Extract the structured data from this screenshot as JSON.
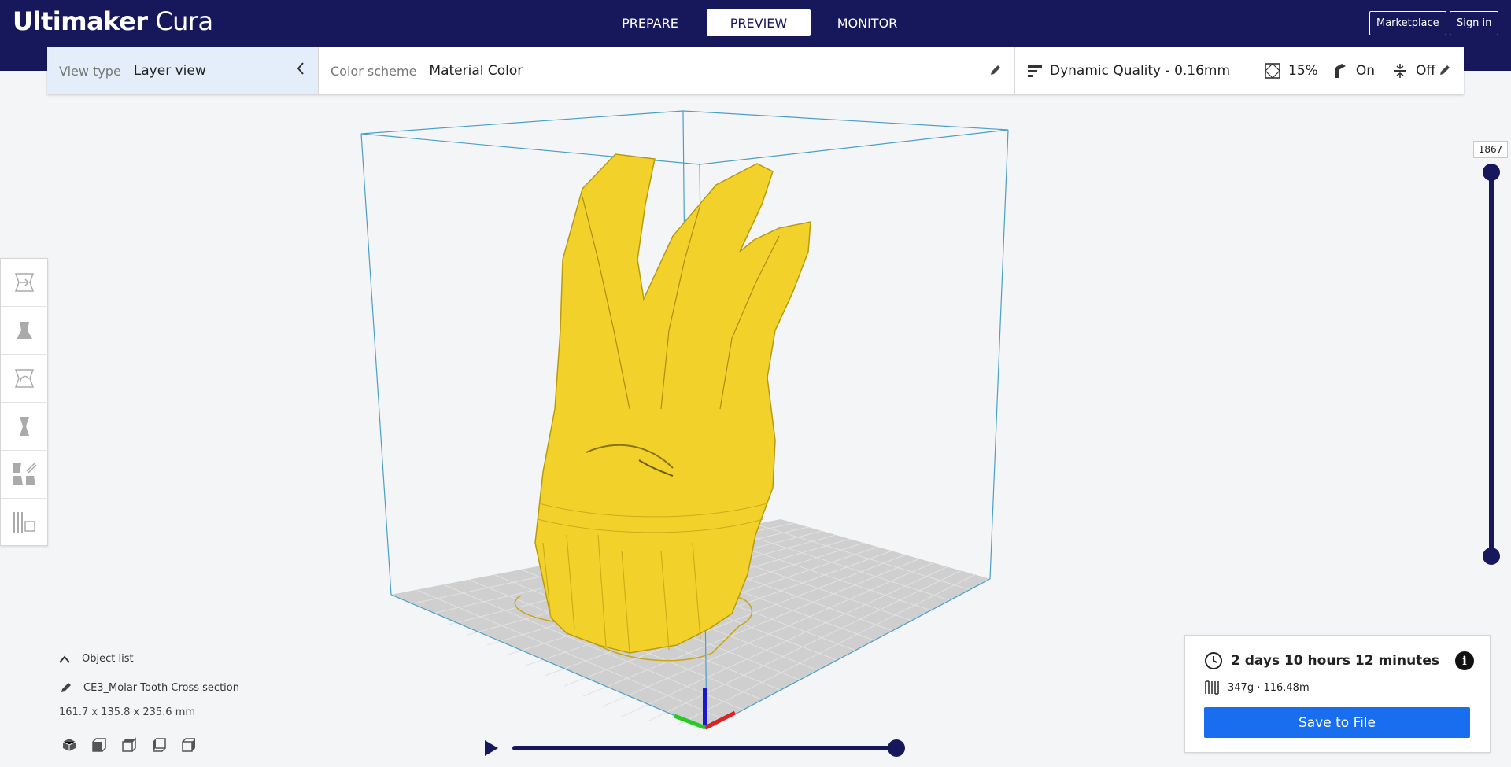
{
  "app": {
    "brand_bold": "Ultimaker",
    "brand_light": "Cura"
  },
  "nav": {
    "tabs": [
      {
        "label": "PREPARE"
      },
      {
        "label": "PREVIEW"
      },
      {
        "label": "MONITOR"
      }
    ],
    "active": "PREVIEW"
  },
  "header": {
    "marketplace_label": "Marketplace",
    "signin_label": "Sign in"
  },
  "toolbar": {
    "view_type_label": "View type",
    "view_type_value": "Layer view",
    "color_scheme_label": "Color scheme",
    "color_scheme_value": "Material Color",
    "profile": "Dynamic Quality - 0.16mm",
    "infill": "15%",
    "support": "On",
    "adhesion": "Off"
  },
  "left_tools": [
    "move-tool-icon",
    "scale-tool-icon",
    "rotate-tool-icon",
    "mirror-tool-icon",
    "per-model-settings-icon",
    "support-blocker-icon"
  ],
  "layer_slider": {
    "current_layer": "1867",
    "upper_fraction": 1.0,
    "lower_fraction": 0.0
  },
  "object_list": {
    "toggle_label": "Object list",
    "object_name": "CE3_Molar Tooth Cross section",
    "dimensions": "161.7 x 135.8 x 235.6 mm"
  },
  "view_buttons": [
    "3d-view-icon",
    "front-view-icon",
    "top-view-icon",
    "left-view-icon",
    "right-view-icon"
  ],
  "simulation": {
    "progress_fraction": 1.0
  },
  "print_info": {
    "time": "2 days 10 hours 12 minutes",
    "material": "347g · 116.48m",
    "save_label": "Save to File"
  },
  "colors": {
    "header": "#17175c",
    "model": "#f2d22a",
    "accent": "#196ef0",
    "build_volume": "#4a9fc9"
  }
}
